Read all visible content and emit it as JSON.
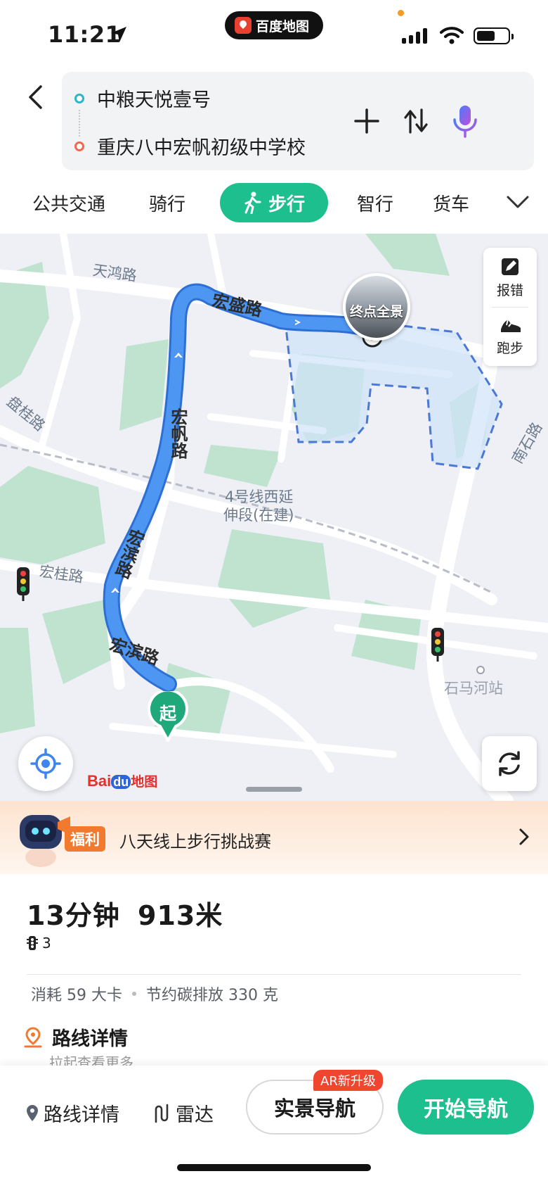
{
  "status_bar": {
    "time": "11:21",
    "app_label": "百度地图"
  },
  "route": {
    "start": "中粮天悦壹号",
    "end": "重庆八中宏帆初级中学校"
  },
  "modes": [
    "公共交通",
    "骑行",
    "步行",
    "智行",
    "货车"
  ],
  "active_mode": "步行",
  "map": {
    "labels": {
      "tianhong": "天鸿路",
      "hongsheng": "宏盛路",
      "hongfan": "宏帆路",
      "hongbin1": "宏滨路",
      "hongbin2": "宏滨路",
      "panggui": "盘桂路",
      "honggui": "宏桂路",
      "line4a": "4号线西延",
      "line4b": "伸段(在建)",
      "nanshi": "南石路",
      "shima": "石马河站"
    },
    "tools": {
      "report": "报错",
      "run": "跑步"
    },
    "pano_label": "终点全景",
    "start_marker": "起",
    "logo": {
      "bai": "Bai",
      "du": "du",
      "ditu": "地图"
    }
  },
  "promo": {
    "badge": "福利",
    "text": "八天线上步行挑战赛"
  },
  "summary": {
    "time": "13分钟",
    "distance": "913米",
    "traffic_lights": "3",
    "calories": "消耗 59 大卡",
    "carbon": "节约碳排放 330 克",
    "detail_title": "路线详情",
    "detail_sub": "拉起查看更多"
  },
  "bottom_bar": {
    "route_detail": "路线详情",
    "radar": "雷达",
    "ar_badge": "AR新升级",
    "ar_nav": "实景导航",
    "start_nav": "开始导航"
  },
  "colors": {
    "accent": "#1dbf8f",
    "route": "#3f8ef0",
    "start_dot": "#2ab7c9",
    "end_dot": "#f0684f",
    "promo": "#f27a2f"
  }
}
